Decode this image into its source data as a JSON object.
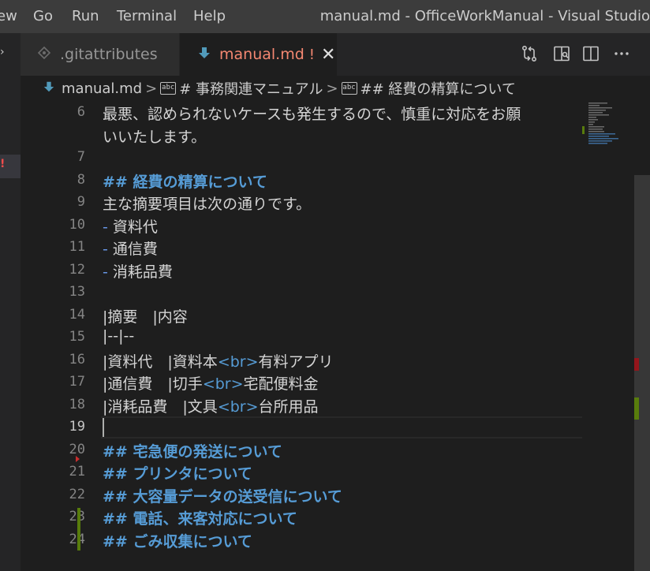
{
  "menu": {
    "items": [
      "ew",
      "Go",
      "Run",
      "Terminal",
      "Help"
    ]
  },
  "window_title": "manual.md - OfficeWorkManual - Visual Studio",
  "sidebar": {
    "chevron": "›",
    "badge": "!"
  },
  "tabs": [
    {
      "label": ".gitattributes",
      "icon": "gear-diamond-icon",
      "active": false
    },
    {
      "label": "manual.md",
      "icon": "markdown-arrow-icon",
      "active": true,
      "status": "!",
      "close": "✕"
    }
  ],
  "breadcrumb": {
    "file": "manual.md",
    "sep": ">",
    "abc": "abc",
    "section1": "# 事務関連マニュアル",
    "section2": "## 経費の精算について"
  },
  "editor": {
    "current_line": 19,
    "lines": [
      {
        "n": "6",
        "text": "最悪、認められないケースも発生するので、慎重に対応をお願"
      },
      {
        "n": "",
        "text": "いいたします。"
      },
      {
        "n": "7",
        "text": ""
      },
      {
        "n": "8",
        "text": "## 経費の精算について"
      },
      {
        "n": "9",
        "text": "主な摘要項目は次の通りです。"
      },
      {
        "n": "10",
        "dash": "-",
        "text": " 資料代"
      },
      {
        "n": "11",
        "dash": "-",
        "text": " 通信費"
      },
      {
        "n": "12",
        "dash": "-",
        "text": " 消耗品費"
      },
      {
        "n": "13",
        "text": ""
      },
      {
        "n": "14",
        "text": "|摘要　|内容"
      },
      {
        "n": "15",
        "text": "|--|--"
      },
      {
        "n": "16",
        "pre": "|資料代　|資料本",
        "tag": "<br>",
        "post": "有料アプリ"
      },
      {
        "n": "17",
        "pre": "|通信費　|切手",
        "tag": "<br>",
        "post": "宅配便料金"
      },
      {
        "n": "18",
        "pre": "|消耗品費　|文具",
        "tag": "<br>",
        "post": "台所用品"
      },
      {
        "n": "19",
        "text": ""
      },
      {
        "n": "20",
        "text": "## 宅急便の発送について"
      },
      {
        "n": "21",
        "text": "## プリンタについて"
      },
      {
        "n": "22",
        "text": "## 大容量データの送受信について"
      },
      {
        "n": "23",
        "text": "## 電話、来客対応について"
      },
      {
        "n": "24",
        "text": "## ごみ収集について"
      }
    ]
  },
  "colors": {
    "heading": "#569cd6",
    "tab_active_text": "#f48771",
    "git_added": "#587c0c",
    "git_deleted": "#94151b"
  }
}
